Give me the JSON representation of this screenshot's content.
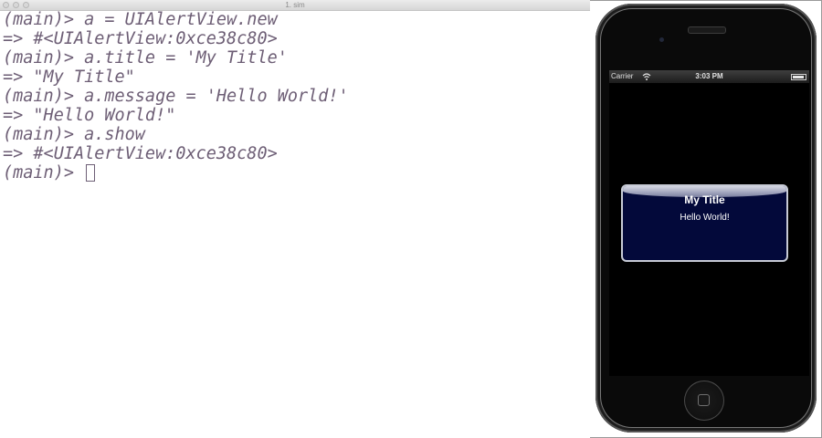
{
  "window": {
    "title": "1. sim"
  },
  "terminal": {
    "lines": [
      "(main)> a = UIAlertView.new",
      "=> #<UIAlertView:0xce38c80>",
      "(main)> a.title = 'My Title'",
      "=> \"My Title\"",
      "(main)> a.message = 'Hello World!'",
      "=> \"Hello World!\"",
      "(main)> a.show",
      "=> #<UIAlertView:0xce38c80>"
    ],
    "prompt": "(main)> "
  },
  "simulator": {
    "status_bar": {
      "carrier": "Carrier",
      "wifi_icon": "wifi-icon",
      "time": "3:03 PM",
      "battery_level": 0.9
    },
    "alert": {
      "title": "My Title",
      "message": "Hello World!"
    }
  },
  "colors": {
    "terminal_text": "#6d5e75",
    "alert_background": "#03093a",
    "device_body": "#0a0a0a"
  }
}
